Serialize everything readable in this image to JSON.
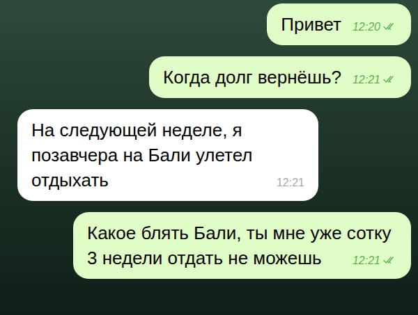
{
  "chat": {
    "messages": [
      {
        "kind": "outgoing",
        "text": "Привет",
        "time": "12:20",
        "read": true
      },
      {
        "kind": "outgoing",
        "text": "Когда долг вернёшь?",
        "time": "12:21",
        "read": true
      },
      {
        "kind": "incoming",
        "text": "На следующей неделе, я позавчера на Бали улетел отдыхать",
        "time": "12:21",
        "read": false
      },
      {
        "kind": "outgoing",
        "text": "Какое блять Бали, ты мне уже сотку 3 недели отдать не можешь",
        "time": "12:21",
        "read": true
      }
    ]
  }
}
